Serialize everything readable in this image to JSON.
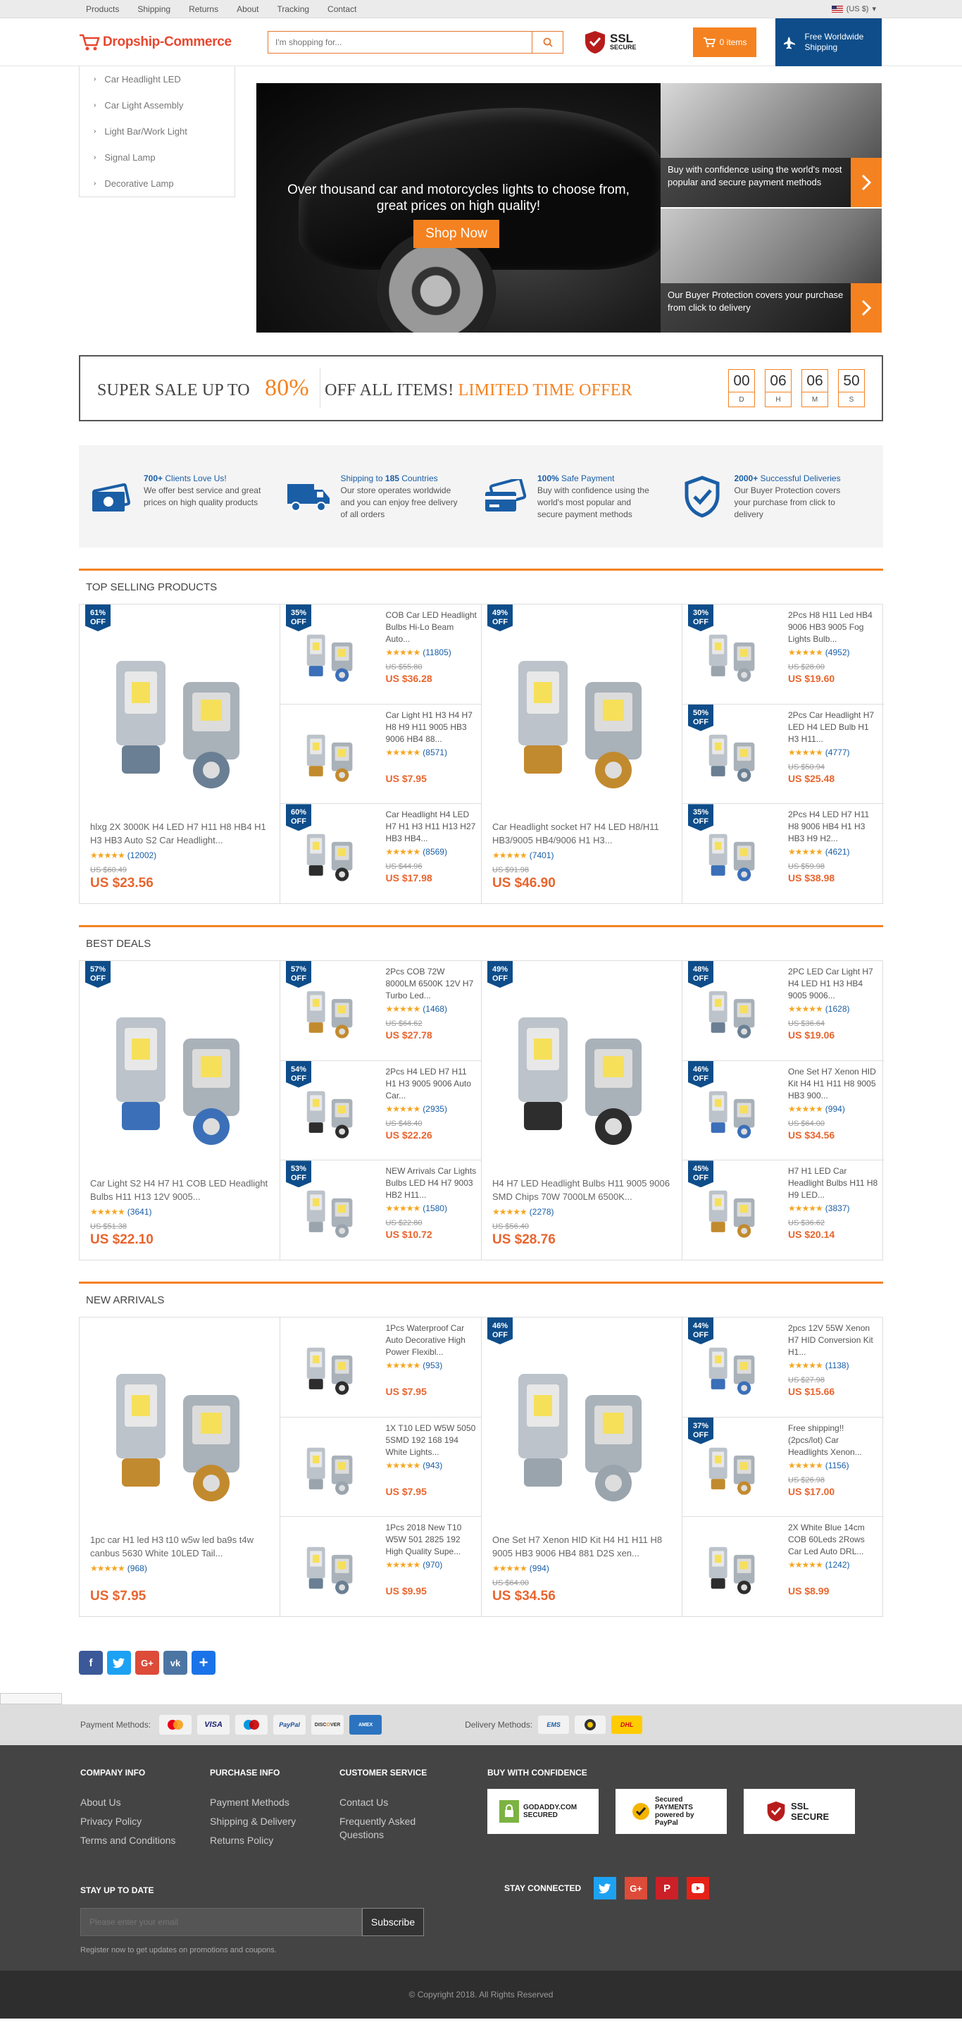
{
  "topbar": {
    "links": [
      "Products",
      "Shipping",
      "Returns",
      "About",
      "Tracking",
      "Contact"
    ],
    "currency": "(US $)"
  },
  "header": {
    "logo_text": "Dropship-Commerce",
    "search_placeholder": "I'm shopping for...",
    "ssl_line1": "SSL",
    "ssl_line2": "SECURE",
    "cart_label": "0 items",
    "shipping_text": "Free Worldwide Shipping"
  },
  "categories": [
    "Car Headlight LED",
    "Car Light Assembly",
    "Light Bar/Work Light",
    "Signal Lamp",
    "Decorative Lamp"
  ],
  "hero": {
    "main_text": "Over thousand car and motorcycles lights to choose from, great prices on high quality!",
    "shop_button": "Shop Now",
    "side1_caption": "Buy with confidence using the world's most popular and secure payment methods",
    "side2_caption": "Our Buyer Protection covers your purchase from click to delivery"
  },
  "sale": {
    "prefix": "SUPER SALE UP TO ",
    "percent": "80%",
    "middle": " OFF ALL ITEMS! ",
    "limited": "LIMITED TIME OFFER",
    "countdown": [
      {
        "n": "00",
        "l": "D"
      },
      {
        "n": "06",
        "l": "H"
      },
      {
        "n": "06",
        "l": "M"
      },
      {
        "n": "50",
        "l": "S"
      }
    ]
  },
  "features": [
    {
      "hl": "700+",
      "hr": " Clients Love Us!",
      "desc": "We offer best service and great prices on high quality products"
    },
    {
      "hl": "Shipping to ",
      "hb": "185",
      "hr": " Countries",
      "desc": "Our store operates worldwide and you can enjoy free delivery of all orders"
    },
    {
      "hl": "100%",
      "hr": " Safe Payment",
      "desc": "Buy with confidence using the world's most popular and secure payment methods"
    },
    {
      "hl": "2000+",
      "hr": " Successful Deliveries",
      "desc": "Our Buyer Protection covers your purchase from click to delivery"
    }
  ],
  "sections": [
    {
      "title": "TOP SELLING PRODUCTS",
      "products": [
        {
          "badge": "61%",
          "name": "hlxg 2X 3000K H4 LED H7 H11 H8 HB4 H1 H3 HB3 Auto S2 Car Headlight...",
          "reviews": "(12002)",
          "old": "US $60.49",
          "price": "US $23.56"
        },
        {
          "badge": "35%",
          "name": "COB Car LED Headlight Bulbs Hi-Lo Beam Auto...",
          "reviews": "(11805)",
          "old": "US $55.80",
          "price": "US $36.28"
        },
        {
          "badge": "",
          "name": "Car Light H1 H3 H4 H7 H8 H9 H11 9005 HB3 9006 HB4 88...",
          "reviews": "(8571)",
          "old": "",
          "price": "US $7.95"
        },
        {
          "badge": "60%",
          "name": "Car Headlight H4 LED H7 H1 H3 H11 H13 H27 HB3 HB4...",
          "reviews": "(8569)",
          "old": "US $44.96",
          "price": "US $17.98"
        },
        {
          "badge": "49%",
          "name": "Car Headlight socket H7 H4 LED H8/H11 HB3/9005 HB4/9006 H1 H3...",
          "reviews": "(7401)",
          "old": "US $91.98",
          "price": "US $46.90"
        },
        {
          "badge": "30%",
          "name": "2Pcs H8 H11 Led HB4 9006 HB3 9005 Fog Lights Bulb...",
          "reviews": "(4952)",
          "old": "US $28.00",
          "price": "US $19.60"
        },
        {
          "badge": "50%",
          "name": "2Pcs Car Headlight H7 LED H4 LED Bulb H1 H3 H11...",
          "reviews": "(4777)",
          "old": "US $50.94",
          "price": "US $25.48"
        },
        {
          "badge": "35%",
          "name": "2Pcs H4 LED H7 H11 H8 9006 HB4 H1 H3 HB3 H9 H2...",
          "reviews": "(4621)",
          "old": "US $59.98",
          "price": "US $38.98"
        }
      ]
    },
    {
      "title": "BEST DEALS",
      "products": [
        {
          "badge": "57%",
          "name": "Car Light S2 H4 H7 H1 COB LED Headlight Bulbs H11 H13 12V 9005...",
          "reviews": "(3641)",
          "old": "US $51.38",
          "price": "US $22.10"
        },
        {
          "badge": "57%",
          "name": "2Pcs COB 72W 8000LM 6500K 12V H7 Turbo Led...",
          "reviews": "(1468)",
          "old": "US $64.62",
          "price": "US $27.78"
        },
        {
          "badge": "54%",
          "name": "2Pcs H4 LED H7 H11 H1 H3 9005 9006 Auto Car...",
          "reviews": "(2935)",
          "old": "US $48.40",
          "price": "US $22.26"
        },
        {
          "badge": "53%",
          "name": "NEW Arrivals Car Lights Bulbs LED H4 H7 9003 HB2 H11...",
          "reviews": "(1580)",
          "old": "US $22.80",
          "price": "US $10.72"
        },
        {
          "badge": "49%",
          "name": "H4 H7 LED Headlight Bulbs H11 9005 9006 SMD Chips 70W 7000LM 6500K...",
          "reviews": "(2278)",
          "old": "US $56.40",
          "price": "US $28.76"
        },
        {
          "badge": "48%",
          "name": "2PC LED Car Light H7 H4 LED H1 H3 HB4 9005 9006...",
          "reviews": "(1628)",
          "old": "US $36.64",
          "price": "US $19.06"
        },
        {
          "badge": "46%",
          "name": "One Set H7 Xenon HID Kit H4 H1 H11 H8 9005 HB3 900...",
          "reviews": "(994)",
          "old": "US $64.00",
          "price": "US $34.56"
        },
        {
          "badge": "45%",
          "name": "H7 H1 LED Car Headlight Bulbs H11 H8 H9 LED...",
          "reviews": "(3837)",
          "old": "US $36.62",
          "price": "US $20.14"
        }
      ]
    },
    {
      "title": "NEW ARRIVALS",
      "products": [
        {
          "badge": "",
          "name": "1pc car H1 led H3 t10 w5w led ba9s t4w canbus 5630 White 10LED Tail...",
          "reviews": "(968)",
          "old": "",
          "price": "US $7.95"
        },
        {
          "badge": "",
          "name": "1Pcs Waterproof Car Auto Decorative High Power Flexibl...",
          "reviews": "(953)",
          "old": "",
          "price": "US $7.95"
        },
        {
          "badge": "",
          "name": "1X T10 LED W5W 5050 5SMD 192 168 194 White Lights...",
          "reviews": "(943)",
          "old": "",
          "price": "US $7.95"
        },
        {
          "badge": "",
          "name": "1Pcs 2018 New T10 W5W 501 2825 192 High Quality Supe...",
          "reviews": "(970)",
          "old": "",
          "price": "US $9.95"
        },
        {
          "badge": "46%",
          "name": "One Set H7 Xenon HID Kit H4 H1 H11 H8 9005 HB3 9006 HB4 881 D2S xen...",
          "reviews": "(994)",
          "old": "US $64.00",
          "price": "US $34.56"
        },
        {
          "badge": "44%",
          "name": "2pcs 12V 55W Xenon H7 HID Conversion Kit H1...",
          "reviews": "(1138)",
          "old": "US $27.98",
          "price": "US $15.66"
        },
        {
          "badge": "37%",
          "name": "Free shipping!! (2pcs/lot) Car Headlights Xenon...",
          "reviews": "(1156)",
          "old": "US $26.98",
          "price": "US $17.00"
        },
        {
          "badge": "",
          "name": "2X White Blue 14cm COB 60Leds 2Rows Car Led Auto DRL...",
          "reviews": "(1242)",
          "old": "",
          "price": "US $8.99"
        }
      ]
    }
  ],
  "footer": {
    "payment_label": "Payment Methods:",
    "cards": [
      {
        "t": "MasterCard",
        "c": "#f2f2f2"
      },
      {
        "t": "VISA",
        "c": "#1a1f71"
      },
      {
        "t": "Maestro",
        "c": "#1f5fa8"
      },
      {
        "t": "PayPal",
        "c": "#1d4e9c"
      },
      {
        "t": "DISCOVER",
        "c": "#f2f2f2"
      },
      {
        "t": "AMEX",
        "c": "#2c74c0"
      }
    ],
    "delivery_label": "Delivery Methods:",
    "couriers": [
      "EMS",
      "Post",
      "DHL"
    ],
    "company": {
      "title": "COMPANY INFO",
      "links": [
        "About Us",
        "Privacy Policy",
        "Terms and Conditions"
      ]
    },
    "purchase": {
      "title": "PURCHASE INFO",
      "links": [
        "Payment Methods",
        "Shipping & Delivery",
        "Returns Policy"
      ]
    },
    "service": {
      "title": "CUSTOMER SERVICE",
      "links": [
        "Contact Us",
        "Frequently Asked Questions"
      ]
    },
    "trust_title": "BUY WITH CONFIDENCE",
    "trust_badges": [
      "GODADDY.COM SECURED",
      "Secured PAYMENTS powered by PayPal",
      "SSL SECURE"
    ],
    "stay_title": "STAY UP TO DATE",
    "email_placeholder": "Please enter your email",
    "subscribe": "Subscribe",
    "note": "Register now to get updates on promotions and coupons.",
    "connected_title": "STAY CONNECTED",
    "copyright": "© Copyright 2018. All Rights Reserved"
  }
}
